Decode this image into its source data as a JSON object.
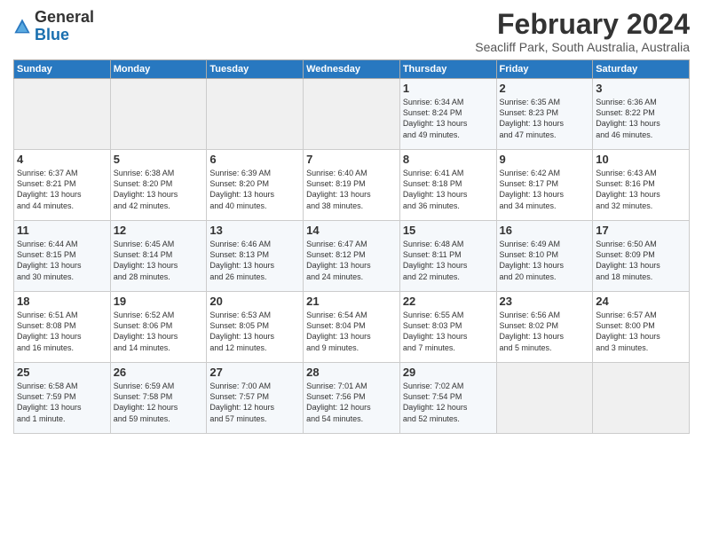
{
  "header": {
    "logo_line1": "General",
    "logo_line2": "Blue",
    "month_year": "February 2024",
    "location": "Seacliff Park, South Australia, Australia"
  },
  "days_of_week": [
    "Sunday",
    "Monday",
    "Tuesday",
    "Wednesday",
    "Thursday",
    "Friday",
    "Saturday"
  ],
  "weeks": [
    [
      {
        "day": "",
        "content": ""
      },
      {
        "day": "",
        "content": ""
      },
      {
        "day": "",
        "content": ""
      },
      {
        "day": "",
        "content": ""
      },
      {
        "day": "1",
        "content": "Sunrise: 6:34 AM\nSunset: 8:24 PM\nDaylight: 13 hours\nand 49 minutes."
      },
      {
        "day": "2",
        "content": "Sunrise: 6:35 AM\nSunset: 8:23 PM\nDaylight: 13 hours\nand 47 minutes."
      },
      {
        "day": "3",
        "content": "Sunrise: 6:36 AM\nSunset: 8:22 PM\nDaylight: 13 hours\nand 46 minutes."
      }
    ],
    [
      {
        "day": "4",
        "content": "Sunrise: 6:37 AM\nSunset: 8:21 PM\nDaylight: 13 hours\nand 44 minutes."
      },
      {
        "day": "5",
        "content": "Sunrise: 6:38 AM\nSunset: 8:20 PM\nDaylight: 13 hours\nand 42 minutes."
      },
      {
        "day": "6",
        "content": "Sunrise: 6:39 AM\nSunset: 8:20 PM\nDaylight: 13 hours\nand 40 minutes."
      },
      {
        "day": "7",
        "content": "Sunrise: 6:40 AM\nSunset: 8:19 PM\nDaylight: 13 hours\nand 38 minutes."
      },
      {
        "day": "8",
        "content": "Sunrise: 6:41 AM\nSunset: 8:18 PM\nDaylight: 13 hours\nand 36 minutes."
      },
      {
        "day": "9",
        "content": "Sunrise: 6:42 AM\nSunset: 8:17 PM\nDaylight: 13 hours\nand 34 minutes."
      },
      {
        "day": "10",
        "content": "Sunrise: 6:43 AM\nSunset: 8:16 PM\nDaylight: 13 hours\nand 32 minutes."
      }
    ],
    [
      {
        "day": "11",
        "content": "Sunrise: 6:44 AM\nSunset: 8:15 PM\nDaylight: 13 hours\nand 30 minutes."
      },
      {
        "day": "12",
        "content": "Sunrise: 6:45 AM\nSunset: 8:14 PM\nDaylight: 13 hours\nand 28 minutes."
      },
      {
        "day": "13",
        "content": "Sunrise: 6:46 AM\nSunset: 8:13 PM\nDaylight: 13 hours\nand 26 minutes."
      },
      {
        "day": "14",
        "content": "Sunrise: 6:47 AM\nSunset: 8:12 PM\nDaylight: 13 hours\nand 24 minutes."
      },
      {
        "day": "15",
        "content": "Sunrise: 6:48 AM\nSunset: 8:11 PM\nDaylight: 13 hours\nand 22 minutes."
      },
      {
        "day": "16",
        "content": "Sunrise: 6:49 AM\nSunset: 8:10 PM\nDaylight: 13 hours\nand 20 minutes."
      },
      {
        "day": "17",
        "content": "Sunrise: 6:50 AM\nSunset: 8:09 PM\nDaylight: 13 hours\nand 18 minutes."
      }
    ],
    [
      {
        "day": "18",
        "content": "Sunrise: 6:51 AM\nSunset: 8:08 PM\nDaylight: 13 hours\nand 16 minutes."
      },
      {
        "day": "19",
        "content": "Sunrise: 6:52 AM\nSunset: 8:06 PM\nDaylight: 13 hours\nand 14 minutes."
      },
      {
        "day": "20",
        "content": "Sunrise: 6:53 AM\nSunset: 8:05 PM\nDaylight: 13 hours\nand 12 minutes."
      },
      {
        "day": "21",
        "content": "Sunrise: 6:54 AM\nSunset: 8:04 PM\nDaylight: 13 hours\nand 9 minutes."
      },
      {
        "day": "22",
        "content": "Sunrise: 6:55 AM\nSunset: 8:03 PM\nDaylight: 13 hours\nand 7 minutes."
      },
      {
        "day": "23",
        "content": "Sunrise: 6:56 AM\nSunset: 8:02 PM\nDaylight: 13 hours\nand 5 minutes."
      },
      {
        "day": "24",
        "content": "Sunrise: 6:57 AM\nSunset: 8:00 PM\nDaylight: 13 hours\nand 3 minutes."
      }
    ],
    [
      {
        "day": "25",
        "content": "Sunrise: 6:58 AM\nSunset: 7:59 PM\nDaylight: 13 hours\nand 1 minute."
      },
      {
        "day": "26",
        "content": "Sunrise: 6:59 AM\nSunset: 7:58 PM\nDaylight: 12 hours\nand 59 minutes."
      },
      {
        "day": "27",
        "content": "Sunrise: 7:00 AM\nSunset: 7:57 PM\nDaylight: 12 hours\nand 57 minutes."
      },
      {
        "day": "28",
        "content": "Sunrise: 7:01 AM\nSunset: 7:56 PM\nDaylight: 12 hours\nand 54 minutes."
      },
      {
        "day": "29",
        "content": "Sunrise: 7:02 AM\nSunset: 7:54 PM\nDaylight: 12 hours\nand 52 minutes."
      },
      {
        "day": "",
        "content": ""
      },
      {
        "day": "",
        "content": ""
      }
    ]
  ]
}
